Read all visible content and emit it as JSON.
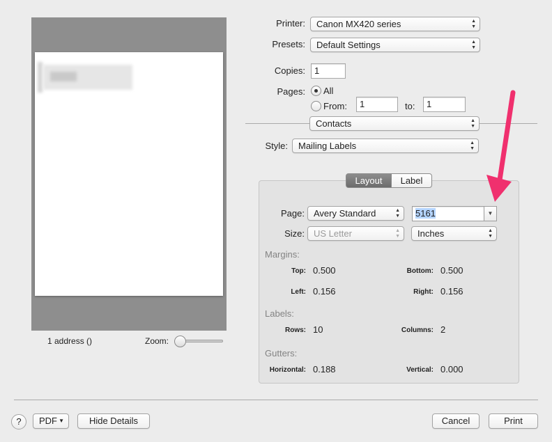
{
  "preview": {
    "status_text": "1 address  ()",
    "zoom_label": "Zoom:"
  },
  "printer": {
    "label": "Printer:",
    "value": "Canon MX420 series"
  },
  "presets": {
    "label": "Presets:",
    "value": "Default Settings"
  },
  "copies": {
    "label": "Copies:",
    "value": "1"
  },
  "pages": {
    "label": "Pages:",
    "all_label": "All",
    "from_label": "From:",
    "from_value": "1",
    "to_label": "to:",
    "to_value": "1",
    "selected": "All"
  },
  "section_popup": {
    "value": "Contacts"
  },
  "style": {
    "label": "Style:",
    "value": "Mailing Labels"
  },
  "tabs": [
    {
      "label": "Layout",
      "selected": true
    },
    {
      "label": "Label",
      "selected": false
    }
  ],
  "layout": {
    "page_label": "Page:",
    "page_value": "Avery Standard",
    "label_code": "5161",
    "size_label": "Size:",
    "size_value": "US Letter",
    "units_value": "Inches",
    "margins_header": "Margins:",
    "top_label": "Top:",
    "top_value": "0.500",
    "bottom_label": "Bottom:",
    "bottom_value": "0.500",
    "left_label": "Left:",
    "left_value": "0.156",
    "right_label": "Right:",
    "right_value": "0.156",
    "labels_header": "Labels:",
    "rows_label": "Rows:",
    "rows_value": "10",
    "columns_label": "Columns:",
    "columns_value": "2",
    "gutters_header": "Gutters:",
    "horizontal_label": "Horizontal:",
    "horizontal_value": "0.188",
    "vertical_label": "Vertical:",
    "vertical_value": "0.000"
  },
  "footer": {
    "help_label": "?",
    "pdf_label": "PDF",
    "hide_details_label": "Hide Details",
    "cancel_label": "Cancel",
    "print_label": "Print"
  },
  "colors": {
    "arrow": "#f0306e",
    "tab_selected": "#7a7a7a",
    "preview_bg": "#8e8e8e"
  }
}
